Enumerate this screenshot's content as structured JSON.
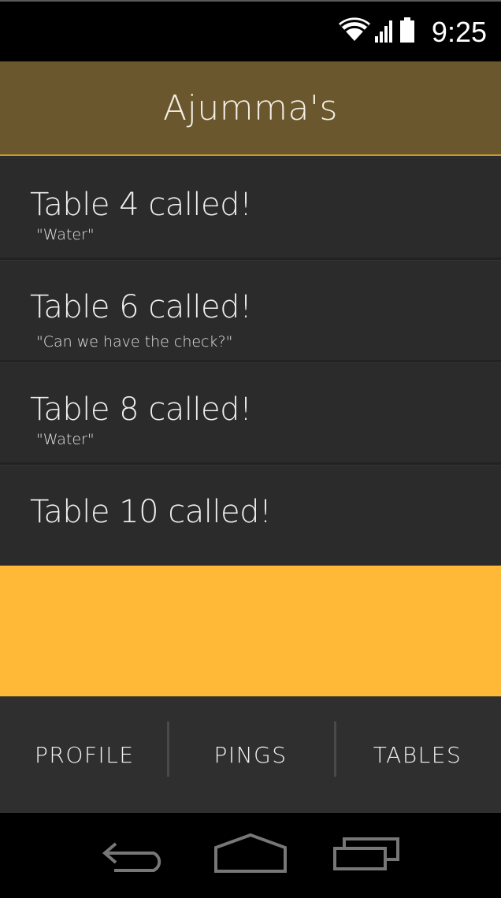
{
  "status_bar": {
    "time": "9:25",
    "icons": [
      "wifi-icon",
      "signal-icon",
      "battery-icon"
    ]
  },
  "header": {
    "title": "Ajumma's"
  },
  "pings": [
    {
      "title": "Table 4 called!",
      "note": "\"Water\""
    },
    {
      "title": "Table 6 called!",
      "note": "\"Can we have the check?\""
    },
    {
      "title": "Table 8 called!",
      "note": "\"Water\""
    },
    {
      "title": "Table 10 called!",
      "note": ""
    }
  ],
  "tabs": [
    {
      "label": "PROFILE"
    },
    {
      "label": "PINGS"
    },
    {
      "label": "TABLES"
    }
  ],
  "nav_bar": {
    "buttons": [
      "back-icon",
      "home-icon",
      "recent-apps-icon"
    ]
  },
  "colors": {
    "header": "#6b572d",
    "accent": "#ffb936",
    "list_bg": "#2b2b2b",
    "tab_bg": "#2f2f2f"
  }
}
